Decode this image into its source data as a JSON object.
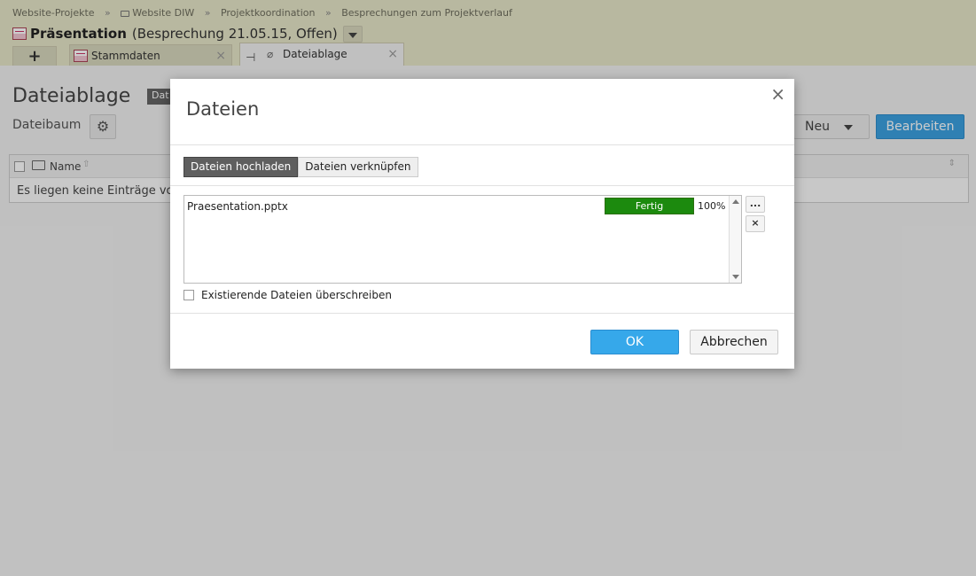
{
  "header": {
    "breadcrumb": [
      "Website-Projekte",
      "Website DIW",
      "Projektkoordination",
      "Besprechungen zum Projektverlauf"
    ],
    "breadcrumb_sep": "»",
    "title": "Präsentation",
    "title_detail": "(Besprechung 21.05.15, Offen)"
  },
  "tabs": {
    "add_label": "+",
    "items": [
      {
        "label": "Stammdaten",
        "close": "×"
      },
      {
        "label": "Dateiablage",
        "close": "×"
      }
    ]
  },
  "page": {
    "title": "Dateiablage",
    "badge": "Dat",
    "subtitle": "Dateibaum",
    "neu_label": "Neu",
    "bearbeiten_label": "Bearbeiten",
    "grid": {
      "column_name": "Name",
      "empty_text": "Es liegen keine Einträge vor."
    }
  },
  "dialog": {
    "title": "Dateien",
    "close": "×",
    "tabs": [
      "Dateien hochladen",
      "Dateien verknüpfen"
    ],
    "active_tab": "Dateien hochladen",
    "files": [
      {
        "name": "Praesentation.pptx",
        "status": "Fertig",
        "progress": 100,
        "progress_text": "100%"
      }
    ],
    "browse_label": "...",
    "remove_label": "×",
    "overwrite_label": "Existierende Dateien überschreiben",
    "overwrite_checked": false,
    "ok_label": "OK",
    "cancel_label": "Abbrechen"
  },
  "colors": {
    "header_bg": "#e7e6c9",
    "primary_button": "#36a8ea",
    "progress_fill": "#1c8a0e"
  }
}
